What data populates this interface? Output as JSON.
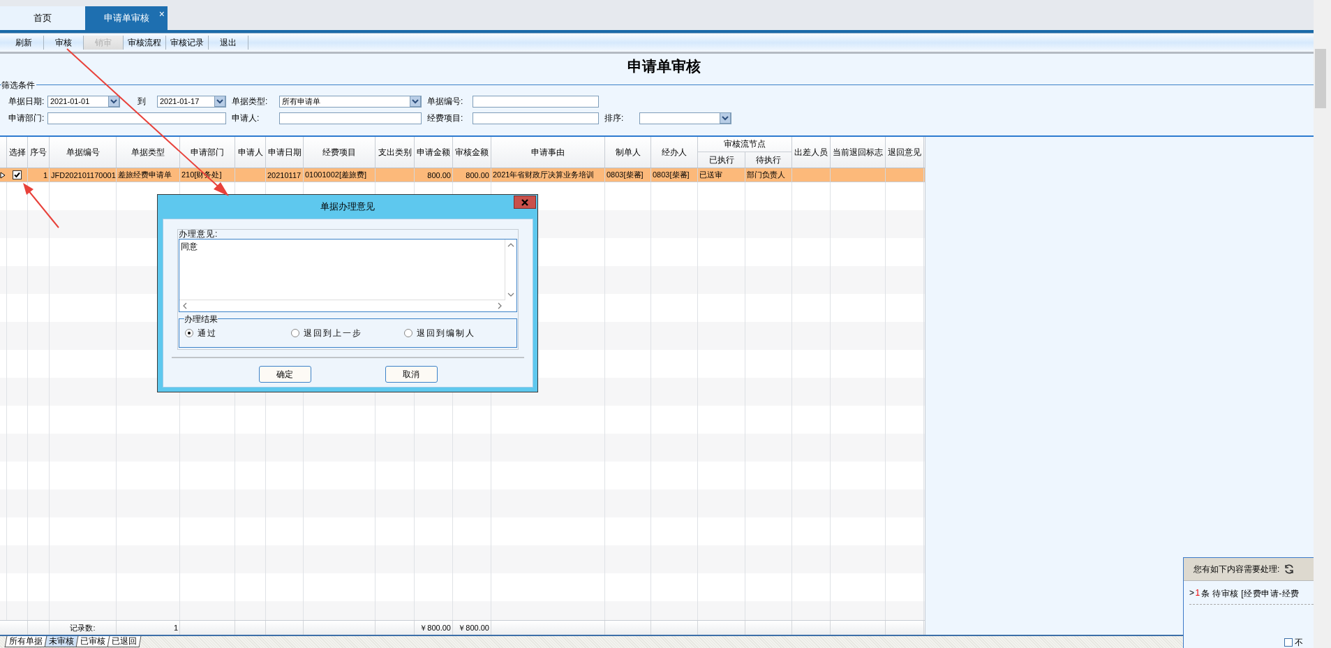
{
  "tabs": [
    {
      "label": "首页",
      "selected": false
    },
    {
      "label": "申请单审核",
      "selected": true,
      "close": "×"
    }
  ],
  "toolbar": [
    {
      "label": "刷新",
      "disabled": false
    },
    {
      "label": "审核",
      "disabled": false
    },
    {
      "label": "销审",
      "disabled": true
    },
    {
      "label": "审核流程",
      "disabled": false
    },
    {
      "label": "审核记录",
      "disabled": false
    },
    {
      "label": "退出",
      "disabled": false
    }
  ],
  "page_title": "申请单审核",
  "filters": {
    "legend": "筛选条件",
    "fields": [
      {
        "label": "单据日期:",
        "kind": "dropdown",
        "value": "2021-01-01"
      },
      {
        "label": "到",
        "kind": "dropdown",
        "value": "2021-01-17"
      },
      {
        "label": "单据类型:",
        "kind": "dropdown",
        "value": "所有申请单"
      },
      {
        "label": "单据编号:",
        "kind": "text"
      },
      {
        "label": "申请部门:",
        "kind": "text"
      },
      {
        "label": "申请人:",
        "kind": "text"
      },
      {
        "label": "经费项目:",
        "kind": "text"
      },
      {
        "label": "排序:",
        "kind": "dropdown"
      }
    ]
  },
  "table": {
    "columns": [
      {
        "label": "选择"
      },
      {
        "label": "序号"
      },
      {
        "label": "单据编号"
      },
      {
        "label": "单据类型"
      },
      {
        "label": "申请部门"
      },
      {
        "label": "申请人"
      },
      {
        "label": "申请日期"
      },
      {
        "label": "经费项目"
      },
      {
        "label": "支出类别"
      },
      {
        "label": "申请金额"
      },
      {
        "label": "审核金额"
      },
      {
        "label": "申请事由"
      },
      {
        "label": "制单人"
      },
      {
        "label": "经办人"
      },
      {
        "label": "审核流节点",
        "children": [
          {
            "label": "已执行"
          },
          {
            "label": "待执行"
          }
        ]
      },
      {
        "label": "出差人员"
      },
      {
        "label": "当前退回标志"
      },
      {
        "label": "退回意见"
      }
    ],
    "rows": [
      {
        "selected": true,
        "checked": true,
        "cells": [
          "",
          "1",
          "JFD202101170001",
          "差旅经费申请单",
          "210[财务处]",
          "",
          "20210117",
          "01001002[差旅费]",
          "",
          "800.00",
          "800.00",
          "2021年省财政厅决算业务培训",
          "0803[柴蕃]",
          "0803[柴蕃]",
          [
            "已送审",
            "部门负责人"
          ],
          "",
          "",
          ""
        ]
      }
    ],
    "footer": {
      "record_label": "记录数:",
      "record_count": "1",
      "requested_total": "￥800.00",
      "approved_total": "￥800.00"
    }
  },
  "bottom_tabs": [
    {
      "label": "所有单据",
      "selected": false
    },
    {
      "label": "未审核",
      "selected": true
    },
    {
      "label": "已审核",
      "selected": false
    },
    {
      "label": "已退回",
      "selected": false
    }
  ],
  "dialog": {
    "title": "单据办理意见",
    "opinion_label": "办理意见:",
    "opinion": "同意",
    "result_legend": "办理结果",
    "options": [
      {
        "label": "通过",
        "selected": true
      },
      {
        "label": "退回到上一步",
        "selected": false
      },
      {
        "label": "退回到编制人",
        "selected": false
      }
    ],
    "buttons": [
      "确定",
      "取消"
    ]
  },
  "notice": {
    "title": "您有如下内容需要处理:",
    "items": [
      {
        "arrow": ">",
        "count": "1",
        "text": "条 待审核 [经费申请-经费"
      }
    ],
    "checkbox": {
      "label": "不",
      "checked": false
    }
  }
}
